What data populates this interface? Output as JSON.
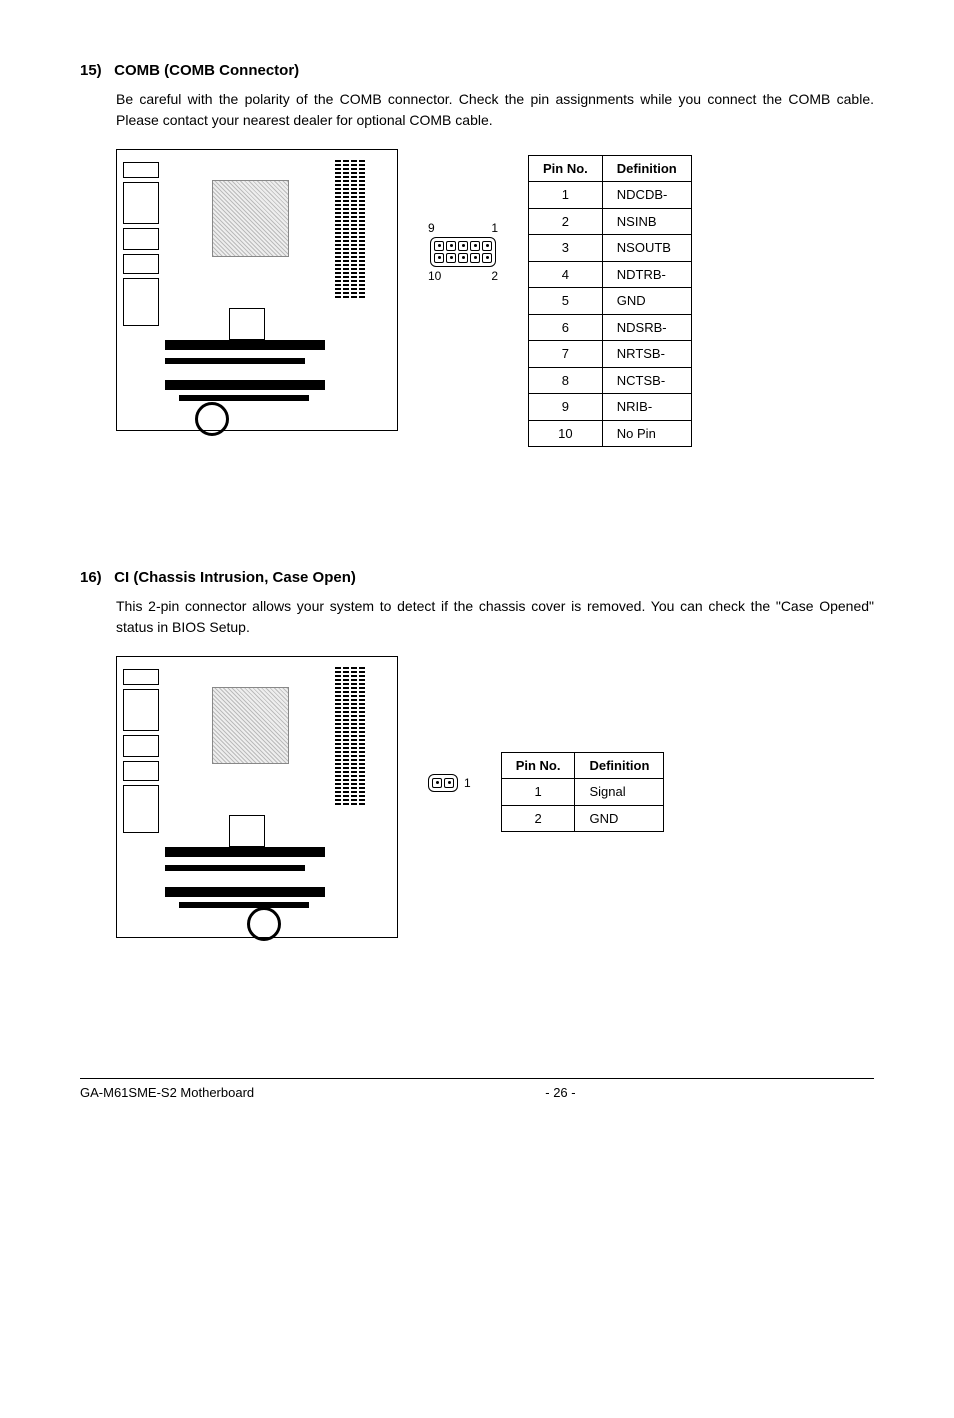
{
  "section15": {
    "number": "15)",
    "title": "COMB (COMB Connector)",
    "body": "Be careful with the polarity of the COMB connector. Check the pin assignments while you connect the COMB cable. Please contact your nearest dealer for optional COMB cable.",
    "pin_labels": {
      "tl": "9",
      "tr": "1",
      "bl": "10",
      "br": "2"
    },
    "table": {
      "headers": [
        "Pin No.",
        "Definition"
      ],
      "rows": [
        [
          "1",
          "NDCDB-"
        ],
        [
          "2",
          "NSINB"
        ],
        [
          "3",
          "NSOUTB"
        ],
        [
          "4",
          "NDTRB-"
        ],
        [
          "5",
          "GND"
        ],
        [
          "6",
          "NDSRB-"
        ],
        [
          "7",
          "NRTSB-"
        ],
        [
          "8",
          "NCTSB-"
        ],
        [
          "9",
          "NRIB-"
        ],
        [
          "10",
          "No Pin"
        ]
      ]
    }
  },
  "section16": {
    "number": "16)",
    "title": "CI (Chassis Intrusion, Case Open)",
    "body": "This 2-pin connector allows your system to detect if the chassis cover is removed. You can check the \"Case Opened\"  status in BIOS Setup.",
    "pin_label": "1",
    "table": {
      "headers": [
        "Pin No.",
        "Definition"
      ],
      "rows": [
        [
          "1",
          "Signal"
        ],
        [
          "2",
          "GND"
        ]
      ]
    }
  },
  "footer": {
    "left": "GA-M61SME-S2 Motherboard",
    "page": "- 26 -"
  }
}
